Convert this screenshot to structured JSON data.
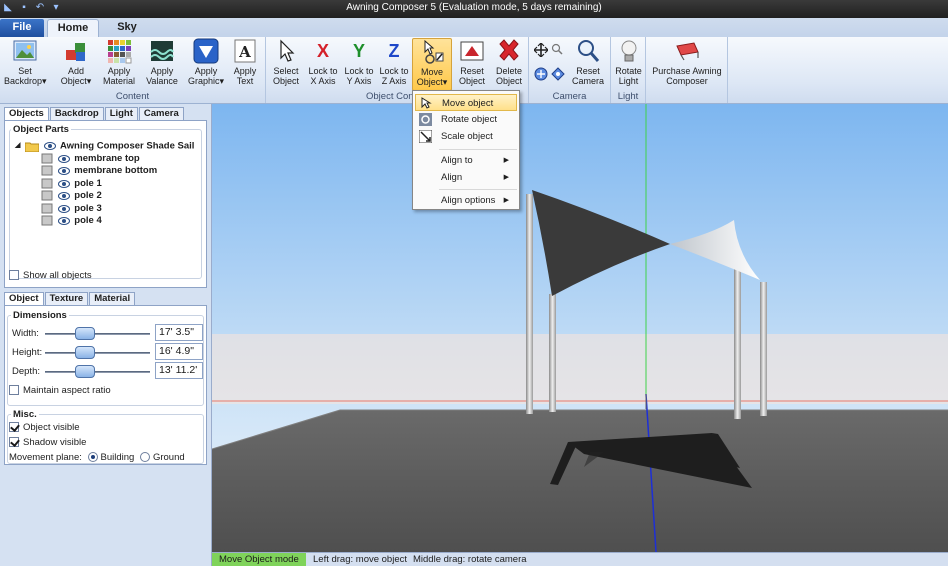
{
  "window": {
    "title": "Awning Composer 5 (Evaluation mode, 5 days remaining)"
  },
  "ribbon_tabs": [
    {
      "label": "File"
    },
    {
      "label": "Home"
    },
    {
      "label": "Sky"
    }
  ],
  "ribbon": {
    "content_group": {
      "label": "Content",
      "buttons": [
        {
          "line1": "Set",
          "line2": "Backdrop▾"
        },
        {
          "line1": "Add",
          "line2": "Object▾"
        },
        {
          "line1": "Apply",
          "line2": "Material"
        },
        {
          "line1": "Apply",
          "line2": "Valance"
        },
        {
          "line1": "Apply",
          "line2": "Graphic▾"
        },
        {
          "line1": "Apply",
          "line2": "Text"
        }
      ]
    },
    "object_group": {
      "label": "Object Con",
      "buttons": [
        {
          "line1": "Select",
          "line2": "Object"
        },
        {
          "line1": "Lock to",
          "line2": "X Axis",
          "glyph": "X"
        },
        {
          "line1": "Lock to",
          "line2": "Y Axis",
          "glyph": "Y"
        },
        {
          "line1": "Lock to",
          "line2": "Z Axis",
          "glyph": "Z"
        },
        {
          "line1": "Move",
          "line2": "Object▾"
        },
        {
          "line1": "Reset",
          "line2": "Object"
        },
        {
          "line1": "Delete",
          "line2": "Object"
        }
      ]
    },
    "camera_group": {
      "label": "Camera",
      "buttons": [
        {
          "line1": "Reset",
          "line2": "Camera"
        }
      ]
    },
    "light_group": {
      "label": "Light",
      "buttons": [
        {
          "line1": "Rotate",
          "line2": "Light"
        }
      ]
    },
    "purchase_group": {
      "buttons": [
        {
          "line1": "Purchase Awning",
          "line2": "Composer"
        }
      ]
    }
  },
  "dropdown_menu": {
    "items": [
      {
        "label": "Move object"
      },
      {
        "label": "Rotate object"
      },
      {
        "label": "Scale object"
      },
      {
        "label": "Align to"
      },
      {
        "label": "Align"
      },
      {
        "label": "Align options"
      }
    ]
  },
  "left_panel": {
    "top_tabs": [
      {
        "label": "Objects"
      },
      {
        "label": "Backdrop"
      },
      {
        "label": "Light"
      },
      {
        "label": "Camera"
      }
    ],
    "object_parts": {
      "legend": "Object Parts",
      "root": "Awning Composer Shade Sail",
      "children": [
        "membrane top",
        "membrane bottom",
        "pole 1",
        "pole 2",
        "pole 3",
        "pole 4"
      ],
      "show_all_label": "Show all objects"
    },
    "bottom_tabs": [
      {
        "label": "Object"
      },
      {
        "label": "Texture"
      },
      {
        "label": "Material"
      }
    ],
    "dimensions": {
      "legend": "Dimensions",
      "width_label": "Width:",
      "width_value": "17' 3.5\"",
      "height_label": "Height:",
      "height_value": "16' 4.9\"",
      "depth_label": "Depth:",
      "depth_value": "13' 11.2'",
      "maintain_label": "Maintain aspect ratio"
    },
    "misc": {
      "legend": "Misc.",
      "object_visible_label": "Object visible",
      "shadow_visible_label": "Shadow visible",
      "movement_plane_label": "Movement plane:",
      "building_label": "Building",
      "ground_label": "Ground"
    }
  },
  "status_bar": {
    "mode": "Move Object mode",
    "hint_left": "Left drag: move object",
    "hint_middle": "Middle drag: rotate camera"
  },
  "colors": {
    "accent": "#ffc94a",
    "mode_green": "#7fd35a",
    "sky_top": "#7db6f0",
    "ground": "#5b5b5b"
  }
}
